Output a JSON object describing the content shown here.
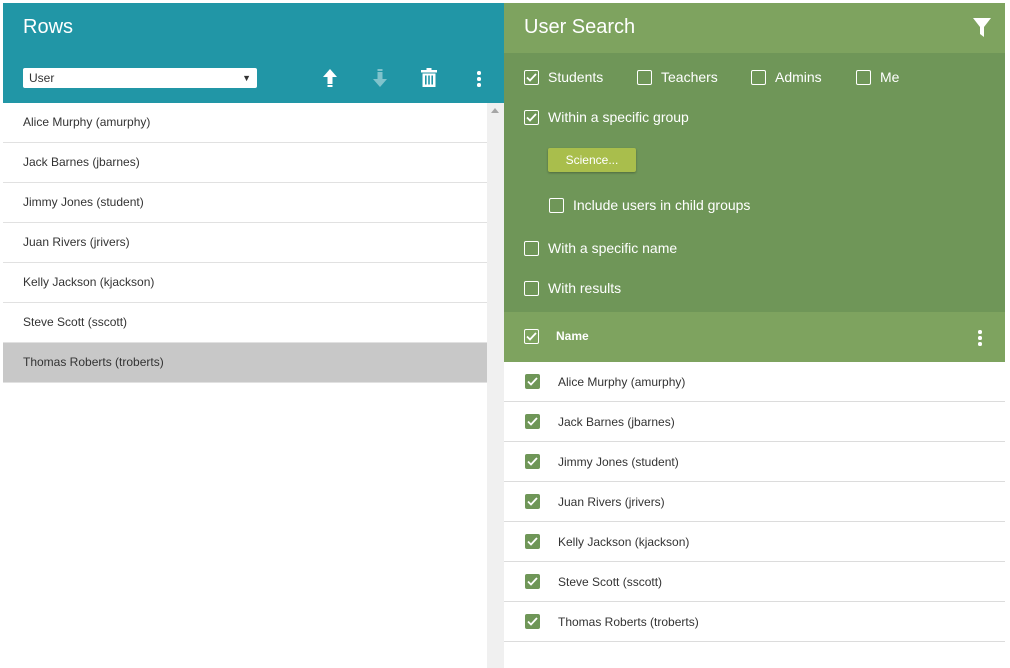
{
  "rows_panel": {
    "title": "Rows",
    "select_value": "User",
    "toolbar": {
      "icons": [
        "move-up-icon",
        "move-down-icon",
        "delete-icon",
        "more-vert-icon"
      ]
    },
    "items": [
      {
        "label": "Alice Murphy (amurphy)",
        "selected": false
      },
      {
        "label": "Jack Barnes (jbarnes)",
        "selected": false
      },
      {
        "label": "Jimmy Jones (student)",
        "selected": false
      },
      {
        "label": "Juan Rivers (jrivers)",
        "selected": false
      },
      {
        "label": "Kelly Jackson (kjackson)",
        "selected": false
      },
      {
        "label": "Steve Scott (sscott)",
        "selected": false
      },
      {
        "label": "Thomas Roberts (troberts)",
        "selected": true
      }
    ]
  },
  "user_search": {
    "title": "User Search",
    "role_filters": [
      {
        "label": "Students",
        "checked": true
      },
      {
        "label": "Teachers",
        "checked": false
      },
      {
        "label": "Admins",
        "checked": false
      },
      {
        "label": "Me",
        "checked": false
      }
    ],
    "within_group": {
      "label": "Within a specific group",
      "checked": true
    },
    "group_button": "Science...",
    "include_child": {
      "label": "Include users in child groups",
      "checked": false
    },
    "specific_name": {
      "label": "With a specific name",
      "checked": false
    },
    "with_results": {
      "label": "With results",
      "checked": false
    },
    "table": {
      "header": "Name",
      "header_checked": true,
      "rows": [
        {
          "label": "Alice Murphy (amurphy)",
          "checked": true
        },
        {
          "label": "Jack Barnes (jbarnes)",
          "checked": true
        },
        {
          "label": "Jimmy Jones (student)",
          "checked": true
        },
        {
          "label": "Juan Rivers (jrivers)",
          "checked": true
        },
        {
          "label": "Kelly Jackson (kjackson)",
          "checked": true
        },
        {
          "label": "Steve Scott (sscott)",
          "checked": true
        },
        {
          "label": "Thomas Roberts (troberts)",
          "checked": true
        }
      ]
    }
  },
  "colors": {
    "rows_header": "#2196a6",
    "search_header": "#7ea35f",
    "search_filters": "#6f9658",
    "group_button": "#a9be4c",
    "selected_row": "#c8c8c8"
  }
}
